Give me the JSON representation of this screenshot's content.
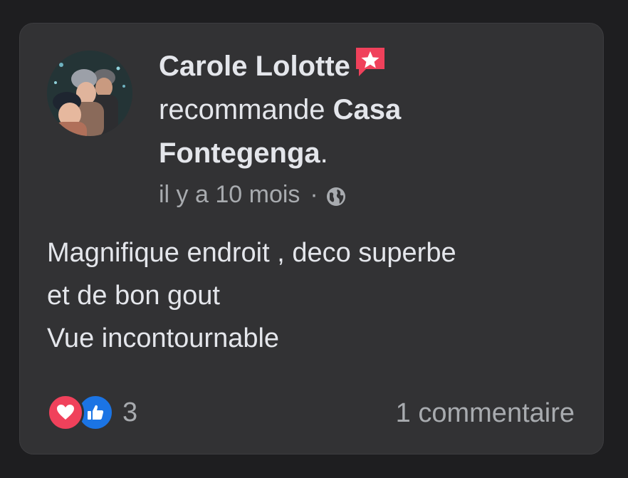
{
  "post": {
    "author": "Carole Lolotte",
    "action": "recommande",
    "page": "Casa Fontegenga",
    "period": ".",
    "time": "il y a 10 mois",
    "separator": "·",
    "privacy_icon": "globe-icon",
    "badge_icon": "recommendation-star-icon",
    "review_lines": [
      "Magnifique endroit , deco superbe",
      "et de bon gout",
      "Vue incontournable"
    ]
  },
  "footer": {
    "reaction_icons": [
      "love-reaction-icon",
      "like-reaction-icon"
    ],
    "reaction_count": "3",
    "comments_label": "1 commentaire"
  },
  "colors": {
    "background": "#1e1e20",
    "card": "#323234",
    "primary_text": "#e4e6eb",
    "secondary_text": "#a8abaf",
    "love": "#f0415b",
    "like": "#1b74e4",
    "badge": "#f0415b"
  }
}
